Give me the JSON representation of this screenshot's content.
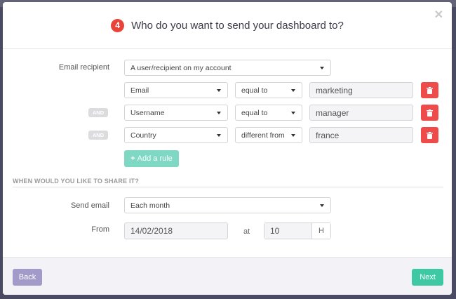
{
  "modal": {
    "step_number": "4",
    "title": "Who do you want to send your dashboard to?",
    "close_icon": "close-icon"
  },
  "recipient": {
    "label": "Email recipient",
    "selected": "A user/recipient on my account"
  },
  "rules": [
    {
      "connector": "",
      "field": "Email",
      "operator": "equal to",
      "value": "marketing"
    },
    {
      "connector": "AND",
      "field": "Username",
      "operator": "equal to",
      "value": "manager"
    },
    {
      "connector": "AND",
      "field": "Country",
      "operator": "different from",
      "value": "france"
    }
  ],
  "add_rule": {
    "icon": "+",
    "label": "Add a rule"
  },
  "schedule": {
    "section_title": "WHEN WOULD YOU LIKE TO SHARE IT?",
    "send_label": "Send email",
    "send_selected": "Each month",
    "from_label": "From",
    "from_date": "14/02/2018",
    "at_label": "at",
    "hour": "10",
    "hour_unit": "H"
  },
  "footer": {
    "back_label": "Back",
    "next_label": "Next"
  },
  "colors": {
    "step_badge": "#e8443a",
    "delete_button": "#ee4b4b",
    "add_rule_button": "#7ed8c3",
    "back_button": "#a29ac9",
    "next_button": "#3ec9a4",
    "overlay": "#4a4b63"
  },
  "icons": {
    "delete": "trash-icon",
    "dropdown": "caret-down-icon"
  }
}
